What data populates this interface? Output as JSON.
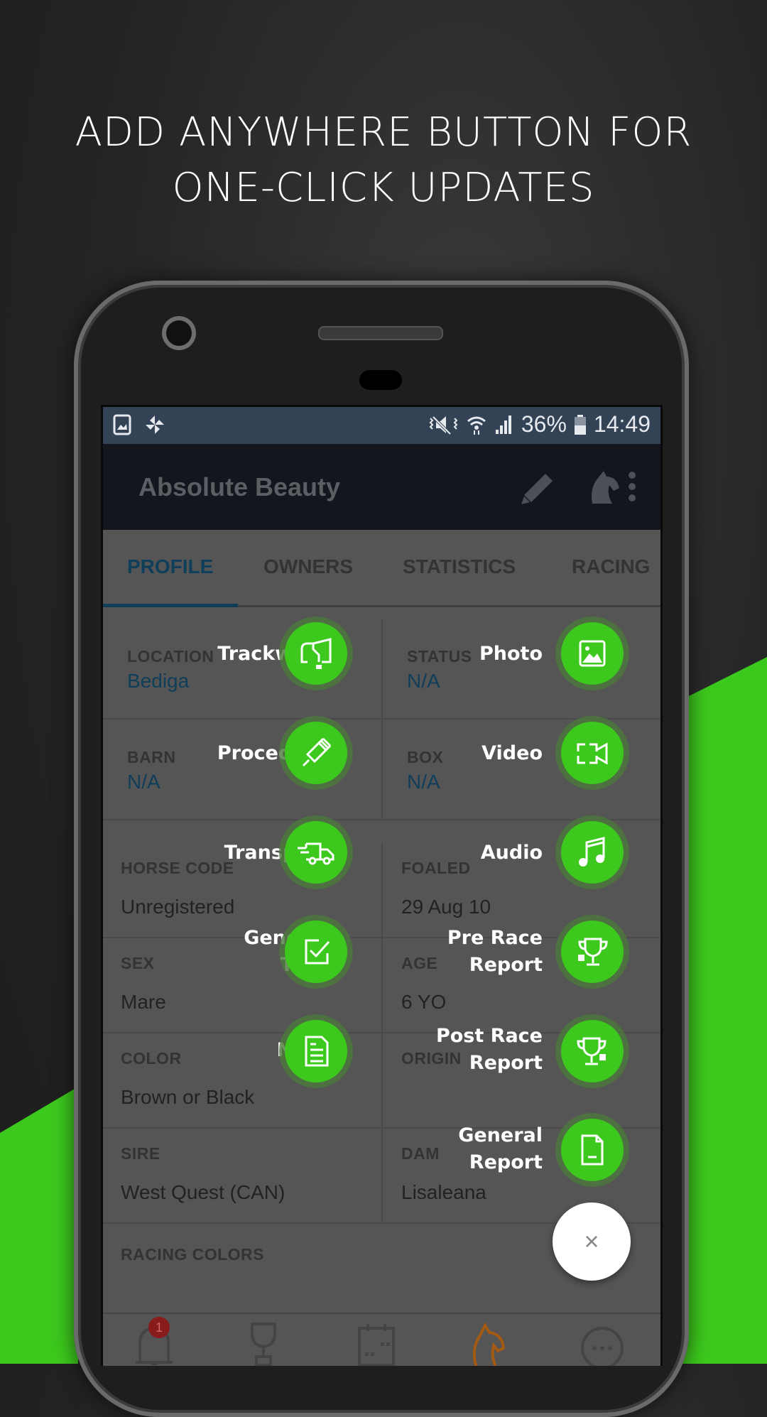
{
  "headline": {
    "line1": "ADD ANYWHERE BUTTON FOR",
    "line2": "ONE-CLICK UPDATES"
  },
  "colors": {
    "brand_green": "#3dc81d",
    "tab_active": "#0f3e5a",
    "status_bar": "#344256",
    "app_bar": "#13161c",
    "nav_active": "#a35a12",
    "badge": "#8a1b1b"
  },
  "status_bar": {
    "left_icons": [
      "gallery-icon",
      "pinwheel-icon"
    ],
    "right_icons": [
      "mute-vibrate-icon",
      "wifi-icon",
      "signal-icon",
      "battery-icon"
    ],
    "battery": "36%",
    "time": "14:49"
  },
  "app_bar": {
    "title": "Absolute Beauty",
    "actions": [
      "edit-icon",
      "horse-menu-icon"
    ]
  },
  "tabs": [
    {
      "label": "PROFILE",
      "active": true
    },
    {
      "label": "OWNERS",
      "active": false
    },
    {
      "label": "STATISTICS",
      "active": false
    },
    {
      "label": "RACING",
      "active": false
    }
  ],
  "profile": {
    "top": [
      {
        "label": "LOCATION",
        "value": "Bediga"
      },
      {
        "label": "STATUS",
        "value": "N/A"
      },
      {
        "label": "BARN",
        "value": "N/A"
      },
      {
        "label": "BOX",
        "value": "N/A"
      }
    ],
    "fields": [
      {
        "label": "HORSE CODE",
        "value": "Unregistered"
      },
      {
        "label": "FOALED",
        "value": "29 Aug 10"
      },
      {
        "label": "SEX",
        "value": "Mare"
      },
      {
        "label": "AGE",
        "value": "6 YO"
      },
      {
        "label": "COLOR",
        "value": "Brown or Black"
      },
      {
        "label": "ORIGIN",
        "value": ""
      },
      {
        "label": "SIRE",
        "value": "West Quest (CAN)"
      },
      {
        "label": "DAM",
        "value": "Lisaleana"
      },
      {
        "label": "RACING COLORS",
        "value": ""
      }
    ]
  },
  "add_menu": {
    "left": [
      {
        "label": "Trackwork",
        "icon": "trackwork-icon"
      },
      {
        "label": "Procedure",
        "icon": "syringe-icon"
      },
      {
        "label": "Transport",
        "icon": "truck-icon"
      },
      {
        "label": "General\nTask",
        "icon": "checkbox-icon"
      },
      {
        "label": "Note",
        "icon": "note-icon"
      }
    ],
    "right": [
      {
        "label": "Photo",
        "icon": "photo-icon"
      },
      {
        "label": "Video",
        "icon": "video-icon"
      },
      {
        "label": "Audio",
        "icon": "music-note-icon"
      },
      {
        "label": "Pre Race\nReport",
        "icon": "trophy-pre-icon"
      },
      {
        "label": "Post Race\nReport",
        "icon": "trophy-post-icon"
      },
      {
        "label": "General\nReport",
        "icon": "report-icon"
      }
    ],
    "close_label": "×"
  },
  "bottom_nav": {
    "items": [
      {
        "name": "notifications",
        "badge": "1"
      },
      {
        "name": "races"
      },
      {
        "name": "calendar"
      },
      {
        "name": "horses",
        "active": true
      },
      {
        "name": "more"
      }
    ]
  }
}
